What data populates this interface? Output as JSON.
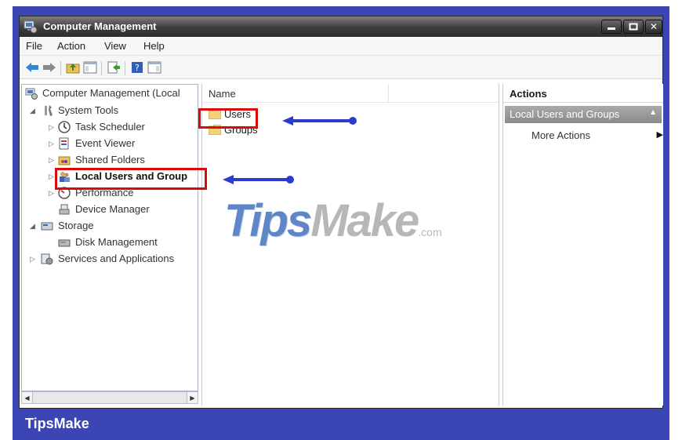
{
  "window": {
    "title": "Computer Management"
  },
  "menu": {
    "items": [
      "File",
      "Action",
      "View",
      "Help"
    ]
  },
  "tree": {
    "root": "Computer Management (Local",
    "system_tools": "System Tools",
    "task_scheduler": "Task Scheduler",
    "event_viewer": "Event Viewer",
    "shared_folders": "Shared Folders",
    "local_users": "Local Users and Group",
    "performance": "Performance",
    "device_manager": "Device Manager",
    "storage": "Storage",
    "disk_management": "Disk Management",
    "services": "Services and Applications"
  },
  "list": {
    "column_name": "Name",
    "rows": [
      "Users",
      "Groups"
    ]
  },
  "actions": {
    "header": "Actions",
    "group_title": "Local Users and Groups",
    "more_actions": "More Actions"
  },
  "watermark": {
    "big": "Tips",
    "mid": "Make",
    "suffix": ".com"
  },
  "footer": {
    "brand": "TipsMake"
  },
  "colors": {
    "frame": "#3b45b4",
    "highlight": "#d80a0a",
    "arrow": "#2b3bd0"
  }
}
